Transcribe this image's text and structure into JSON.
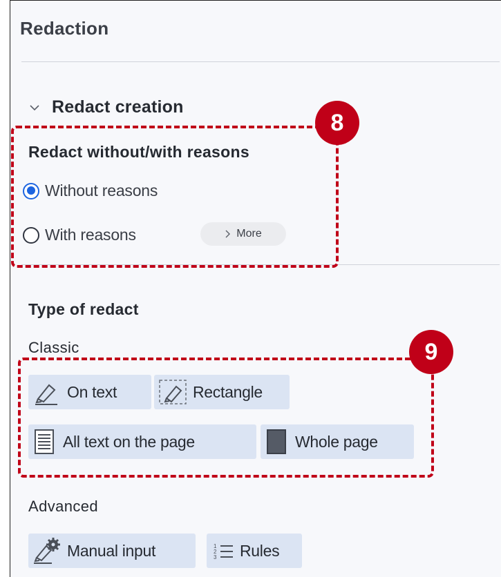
{
  "panel": {
    "title": "Redaction",
    "section_title": "Redact creation",
    "reasons_group": {
      "title": "Redact without/with reasons",
      "options": [
        {
          "label": "Without reasons",
          "checked": true
        },
        {
          "label": "With reasons",
          "checked": false
        }
      ],
      "more_label": "More"
    },
    "type_group": {
      "title": "Type of redact",
      "classic_label": "Classic",
      "classic_buttons": [
        "On text",
        "Rectangle",
        "All text on the page",
        "Whole page"
      ],
      "advanced_label": "Advanced",
      "advanced_buttons": [
        "Manual input",
        "Rules"
      ]
    }
  },
  "annotations": {
    "badge_1": "8",
    "badge_2": "9",
    "color": "#c00018"
  },
  "colors": {
    "accent": "#1c64e0",
    "button_bg": "#dbe4f3"
  }
}
